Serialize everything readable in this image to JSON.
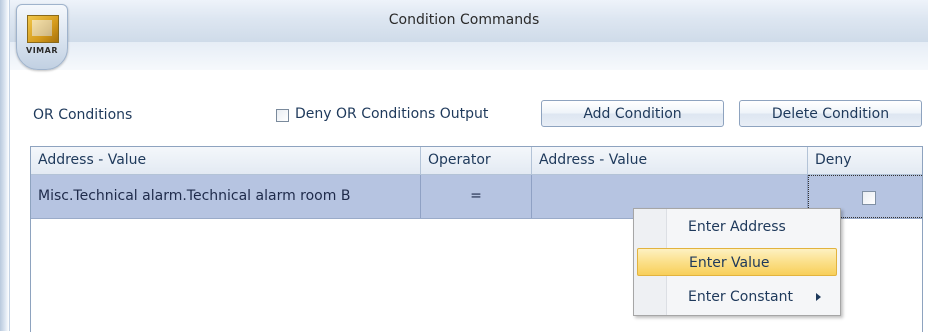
{
  "window": {
    "title": "Condition Commands"
  },
  "app_button": {
    "brand": "VIMAR"
  },
  "or_conditions": {
    "label": "OR Conditions",
    "deny_output_label": "Deny OR Conditions Output",
    "deny_output_checked": false
  },
  "buttons": {
    "add": "Add Condition",
    "delete": "Delete Condition"
  },
  "grid": {
    "columns": [
      "Address - Value",
      "Operator",
      "Address - Value",
      "Deny"
    ],
    "rows": [
      {
        "address_value_1": "Misc.Technical alarm.Technical alarm room B",
        "operator": "=",
        "address_value_2": "",
        "deny": false
      }
    ]
  },
  "context_menu": {
    "items": [
      {
        "label": "Enter Address",
        "highlighted": false,
        "submenu": false
      },
      {
        "label": "Enter Value",
        "highlighted": true,
        "submenu": false
      },
      {
        "label": "Enter Constant",
        "highlighted": false,
        "submenu": true
      }
    ]
  }
}
